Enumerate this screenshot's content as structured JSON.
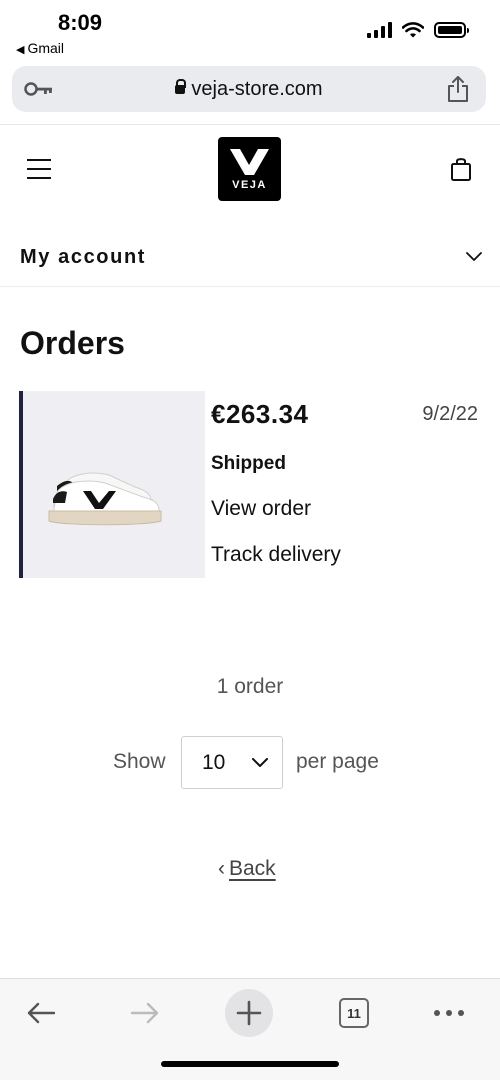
{
  "status_bar": {
    "time": "8:09",
    "back_app": "Gmail"
  },
  "browser": {
    "url": "veja-store.com",
    "tab_count": "11"
  },
  "site": {
    "logo_text": "VEJA"
  },
  "account": {
    "label": "My account"
  },
  "orders": {
    "title": "Orders",
    "items": [
      {
        "total": "€263.34",
        "date": "9/2/22",
        "status": "Shipped",
        "view_label": "View order",
        "track_label": "Track delivery"
      }
    ],
    "count_text": "1 order"
  },
  "pagination": {
    "show_label": "Show",
    "per_page_value": "10",
    "per_page_label": "per page"
  },
  "back_label": "Back",
  "colors": {
    "card_accent": "#1f2340",
    "card_image_bg": "#efeff3",
    "urlbar_bg": "#e9ebee"
  }
}
